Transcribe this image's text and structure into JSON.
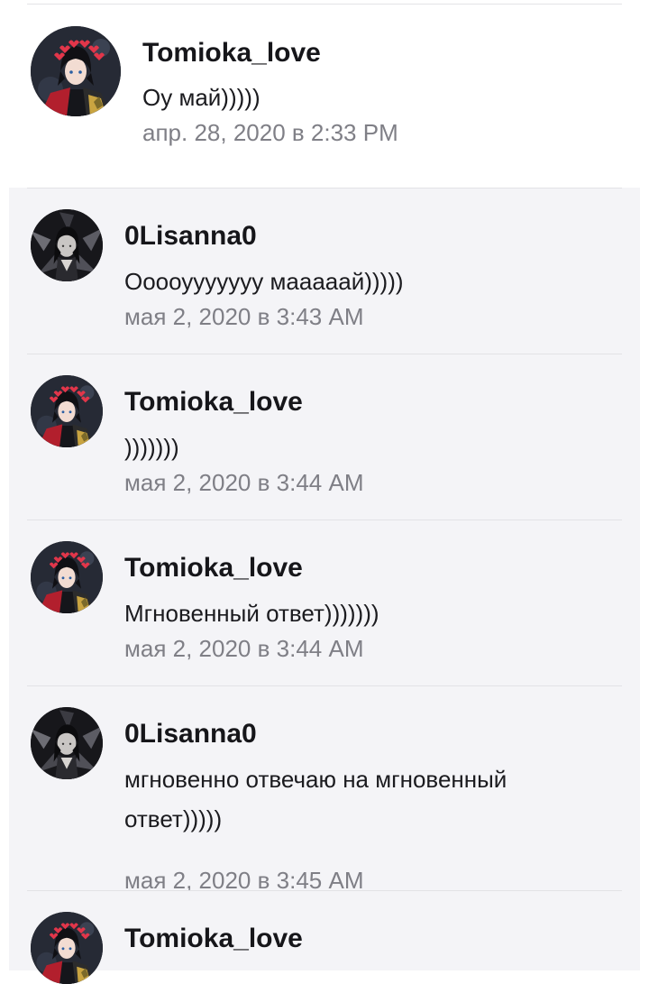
{
  "comments": [
    {
      "user": "Tomioka_love",
      "avatar": "tomioka-avatar",
      "text": "Оу май)))))",
      "time": "апр. 28, 2020 в 2:33 PM"
    },
    {
      "user": "0Lisanna0",
      "avatar": "lisanna-avatar",
      "text": "Ооооууууууу мааааай)))))",
      "time": "мая 2, 2020 в 3:43 AM"
    },
    {
      "user": "Tomioka_love",
      "avatar": "tomioka-avatar",
      "text": ")))))))",
      "time": "мая 2, 2020 в 3:44 AM"
    },
    {
      "user": "Tomioka_love",
      "avatar": "tomioka-avatar",
      "text": "Мгновенный ответ)))))))",
      "time": "мая 2, 2020 в 3:44 AM"
    },
    {
      "user": "0Lisanna0",
      "avatar": "lisanna-avatar",
      "text": "мгновенно отвечаю на мгновенный ответ)))))",
      "time": "мая 2, 2020 в 3:45 AM"
    },
    {
      "user": "Tomioka_love",
      "avatar": "tomioka-avatar",
      "text": "",
      "time": ""
    }
  ],
  "colors": {
    "reply_background": "#f4f4f7",
    "username": "#16161a",
    "timestamp": "#7f7f86",
    "divider": "#e2e2e6"
  }
}
